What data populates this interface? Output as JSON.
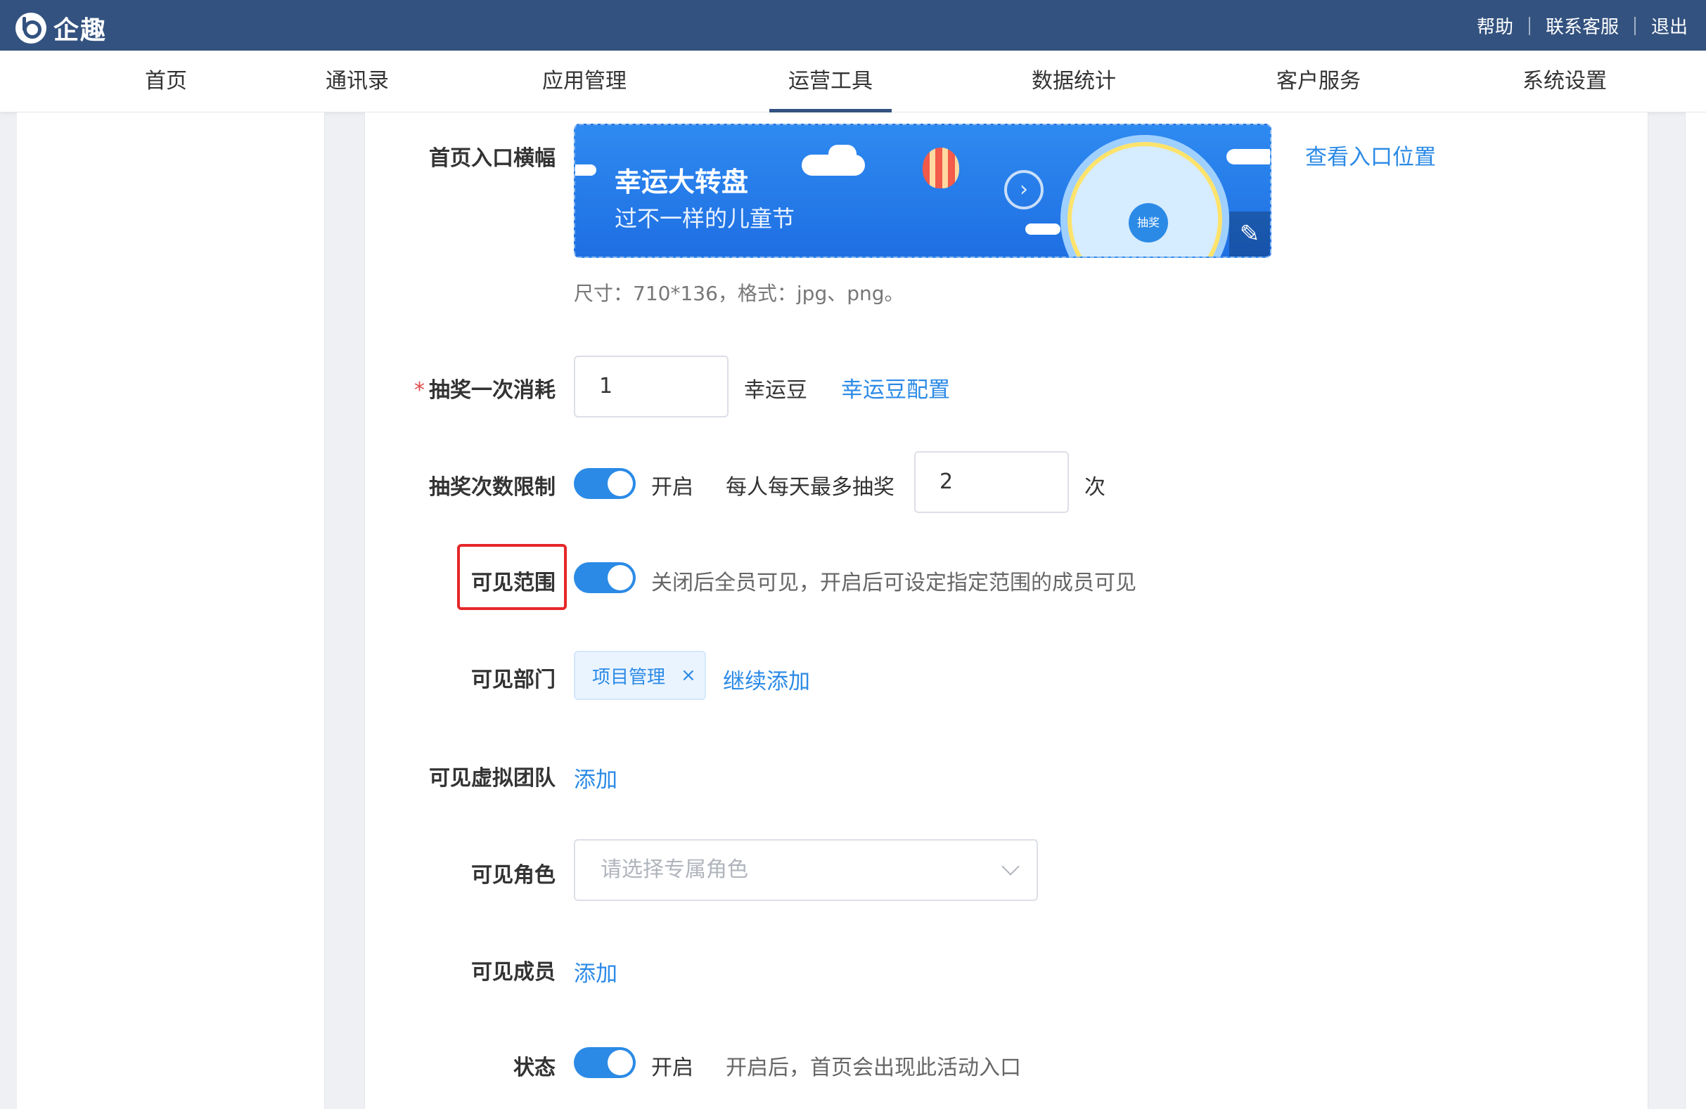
{
  "app": {
    "name": "企趣",
    "top_links": [
      "帮助",
      "联系客服",
      "退出"
    ]
  },
  "nav": {
    "items": [
      "首页",
      "通讯录",
      "应用管理",
      "运营工具",
      "数据统计",
      "客户服务",
      "系统设置"
    ],
    "active": "运营工具"
  },
  "form": {
    "banner": {
      "label": "首页入口横幅",
      "title": "幸运大转盘",
      "subtitle": "过不一样的儿童节",
      "wheel_center": "抽奖",
      "hint": "尺寸：710*136，格式：jpg、png。",
      "view_link": "查看入口位置"
    },
    "cost": {
      "label": "抽奖一次消耗",
      "required_mark": "*",
      "value": "1",
      "unit": "幸运豆",
      "config_link": "幸运豆配置"
    },
    "limit": {
      "label": "抽奖次数限制",
      "toggle_on": true,
      "toggle_text": "开启",
      "per_day_label": "每人每天最多抽奖",
      "value": "2",
      "unit": "次"
    },
    "scope": {
      "label": "可见范围",
      "toggle_on": true,
      "description": "关闭后全员可见，开启后可设定指定范围的成员可见"
    },
    "departments": {
      "label": "可见部门",
      "tag": "项目管理",
      "tag_close": "×",
      "add_link": "继续添加"
    },
    "virtual_team": {
      "label": "可见虚拟团队",
      "add_link": "添加"
    },
    "role": {
      "label": "可见角色",
      "placeholder": "请选择专属角色"
    },
    "members": {
      "label": "可见成员",
      "add_link": "添加"
    },
    "status": {
      "label": "状态",
      "toggle_on": true,
      "toggle_text": "开启",
      "description": "开启后，首页会出现此活动入口"
    }
  },
  "colors": {
    "topbar": "#33527f",
    "accent": "#2b8ae6",
    "highlight": "#e5272a"
  }
}
